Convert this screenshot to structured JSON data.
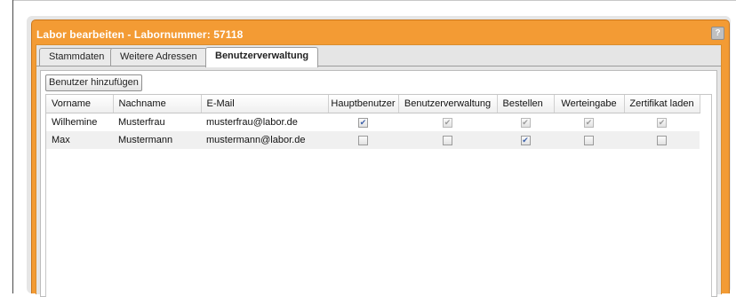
{
  "dialog": {
    "title": "Labor bearbeiten - Labornummer: 57118",
    "help_label": "?"
  },
  "tabs": [
    {
      "label": "Stammdaten"
    },
    {
      "label": "Weitere Adressen"
    },
    {
      "label": "Benutzerverwaltung",
      "active": true
    }
  ],
  "toolbar": {
    "add_user_label": "Benutzer hinzufügen"
  },
  "grid": {
    "columns": [
      "Vorname",
      "Nachname",
      "E-Mail",
      "Hauptbenutzer",
      "Benutzerverwaltung",
      "Bestellen",
      "Werteingabe",
      "Zertifikat laden"
    ],
    "rows": [
      {
        "vorname": "Wilhemine",
        "nachname": "Musterfrau",
        "email": "musterfrau@labor.de",
        "hauptbenutzer": true,
        "benutzerverwaltung": true,
        "bestellen": true,
        "werteingabe": true,
        "zertifikat_laden": true
      },
      {
        "vorname": "Max",
        "nachname": "Mustermann",
        "email": "mustermann@labor.de",
        "hauptbenutzer": false,
        "benutzerverwaltung": false,
        "bestellen": true,
        "werteingabe": false,
        "zertifikat_laden": false
      }
    ]
  },
  "colors": {
    "dialog_frame": "#f39b34",
    "checkbox_check": "#3b5fa8"
  }
}
